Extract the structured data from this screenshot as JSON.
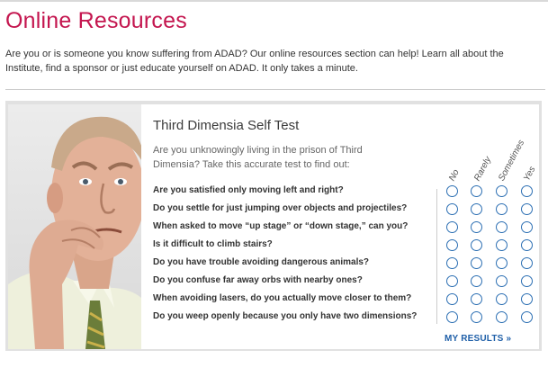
{
  "page": {
    "title": "Online Resources",
    "intro": "Are you or is someone you know suffering from ADAD?  Our online resources section can help!  Learn all about the Institute, find a sponsor or just educate yourself on ADAD.  It only takes a minute."
  },
  "test": {
    "title": "Third Dimensia Self Test",
    "subtitle": "Are you unknowingly living in the prison of Third Dimensia? Take this accurate test to find out:",
    "columns": [
      "No",
      "Rarely",
      "Sometimes",
      "Yes"
    ],
    "questions": [
      "Are you satisfied only moving left and right?",
      "Do you settle for just jumping over objects and projectiles?",
      "When asked to move “up stage” or “down stage,” can you?",
      "Is it difficult to climb stairs?",
      "Do you have trouble avoiding dangerous animals?",
      "Do you confuse far away orbs with nearby ones?",
      "When avoiding lasers, do you actually move closer to them?",
      "Do you weep openly because you only have two dimensions?"
    ],
    "results_link": "MY RESULTS »"
  },
  "colors": {
    "title_accent": "#c4164f",
    "radio_border": "#2c6fb3",
    "link": "#1f5fa8"
  },
  "icons": {
    "photo": "worried-man-photo"
  }
}
